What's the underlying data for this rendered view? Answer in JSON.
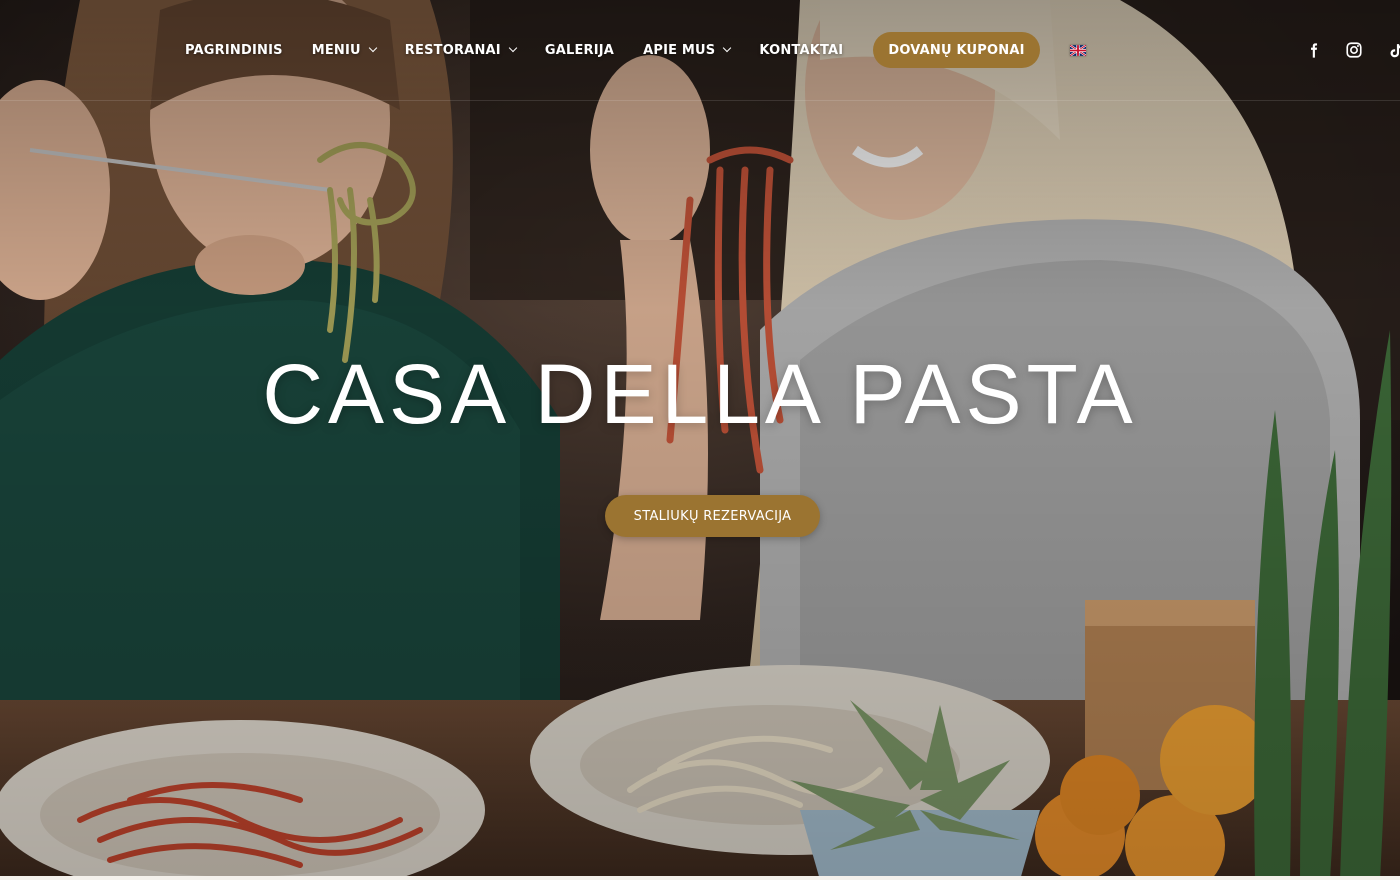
{
  "nav": {
    "items": [
      {
        "label": "PAGRINDINIS",
        "has_dropdown": false
      },
      {
        "label": "MENIU",
        "has_dropdown": true
      },
      {
        "label": "RESTORANAI",
        "has_dropdown": true
      },
      {
        "label": "GALERIJA",
        "has_dropdown": false
      },
      {
        "label": "APIE MUS",
        "has_dropdown": true
      },
      {
        "label": "KONTAKTAI",
        "has_dropdown": false
      }
    ],
    "cta_label": "DOVANŲ KUPONAI",
    "language_icon": "uk-flag-icon"
  },
  "social": {
    "icons": [
      "facebook-icon",
      "instagram-icon",
      "tiktok-icon"
    ]
  },
  "hero": {
    "title": "CASA DELLA PASTA",
    "button_label": "STALIUKŲ REZERVACIJA"
  },
  "colors": {
    "accent": "#9b7431",
    "text": "#ffffff"
  }
}
